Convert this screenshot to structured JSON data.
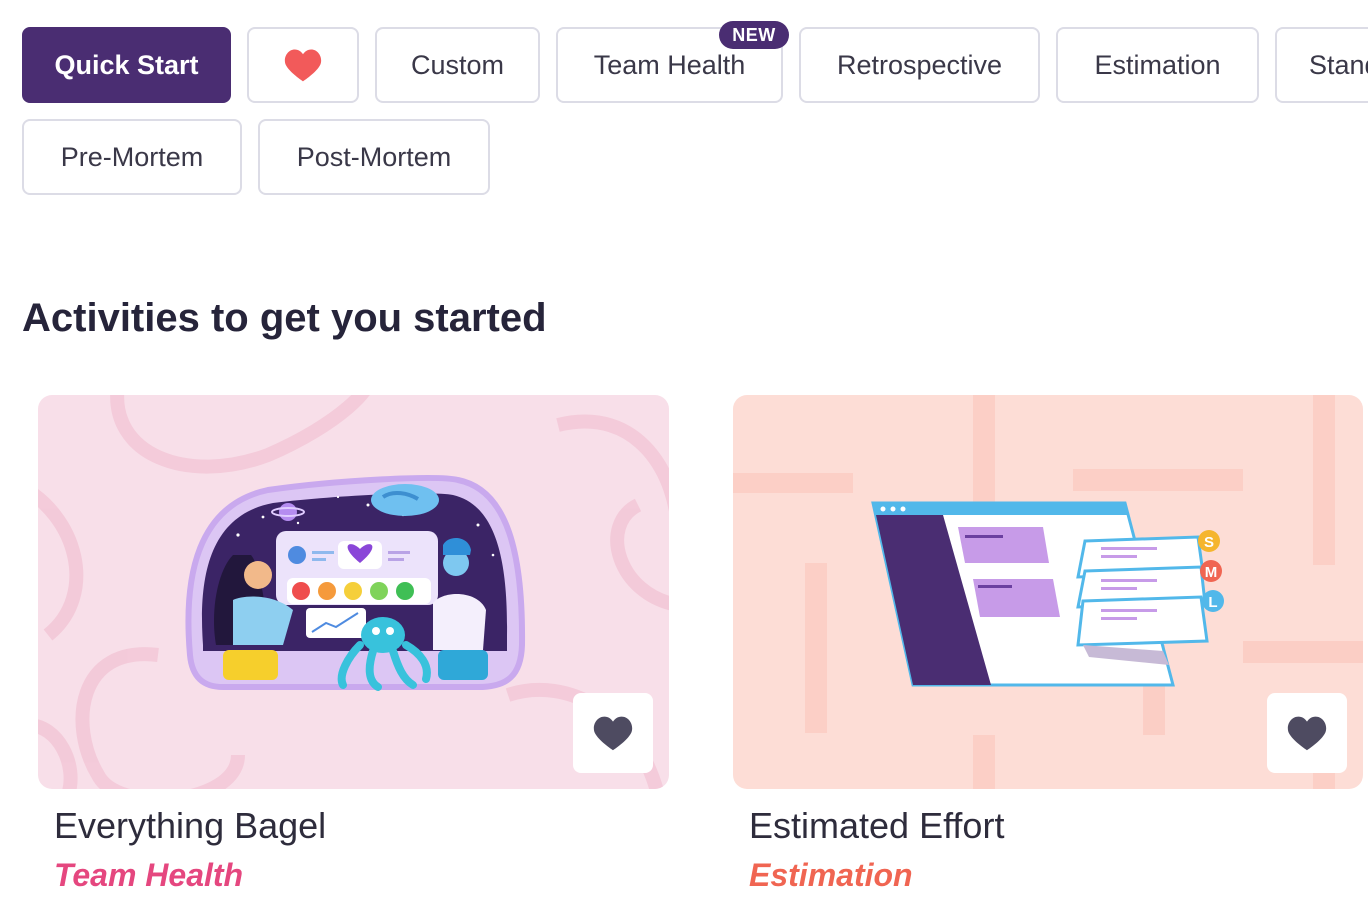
{
  "filters": {
    "quick_start": "Quick Start",
    "favorites_icon": "heart-icon",
    "custom": "Custom",
    "team_health": "Team Health",
    "new_badge": "NEW",
    "retrospective": "Retrospective",
    "estimation": "Estimation",
    "standup_partial": "Stand",
    "pre_mortem": "Pre-Mortem",
    "post_mortem": "Post-Mortem"
  },
  "section": {
    "title": "Activities to get you started"
  },
  "cards": [
    {
      "title": "Everything Bagel",
      "category": "Team Health",
      "category_color": "#e5477f",
      "thumb_bg": "#f8dfe9",
      "favorite_icon": "heart-icon"
    },
    {
      "title": "Estimated Effort",
      "category": "Estimation",
      "category_color": "#f06552",
      "thumb_bg": "#fdddd6",
      "favorite_icon": "heart-icon",
      "size_labels": [
        "S",
        "M",
        "L"
      ]
    }
  ],
  "colors": {
    "accent": "#4a2d72",
    "heart_red": "#f25a5a",
    "heart_dark": "#4e4b61"
  }
}
